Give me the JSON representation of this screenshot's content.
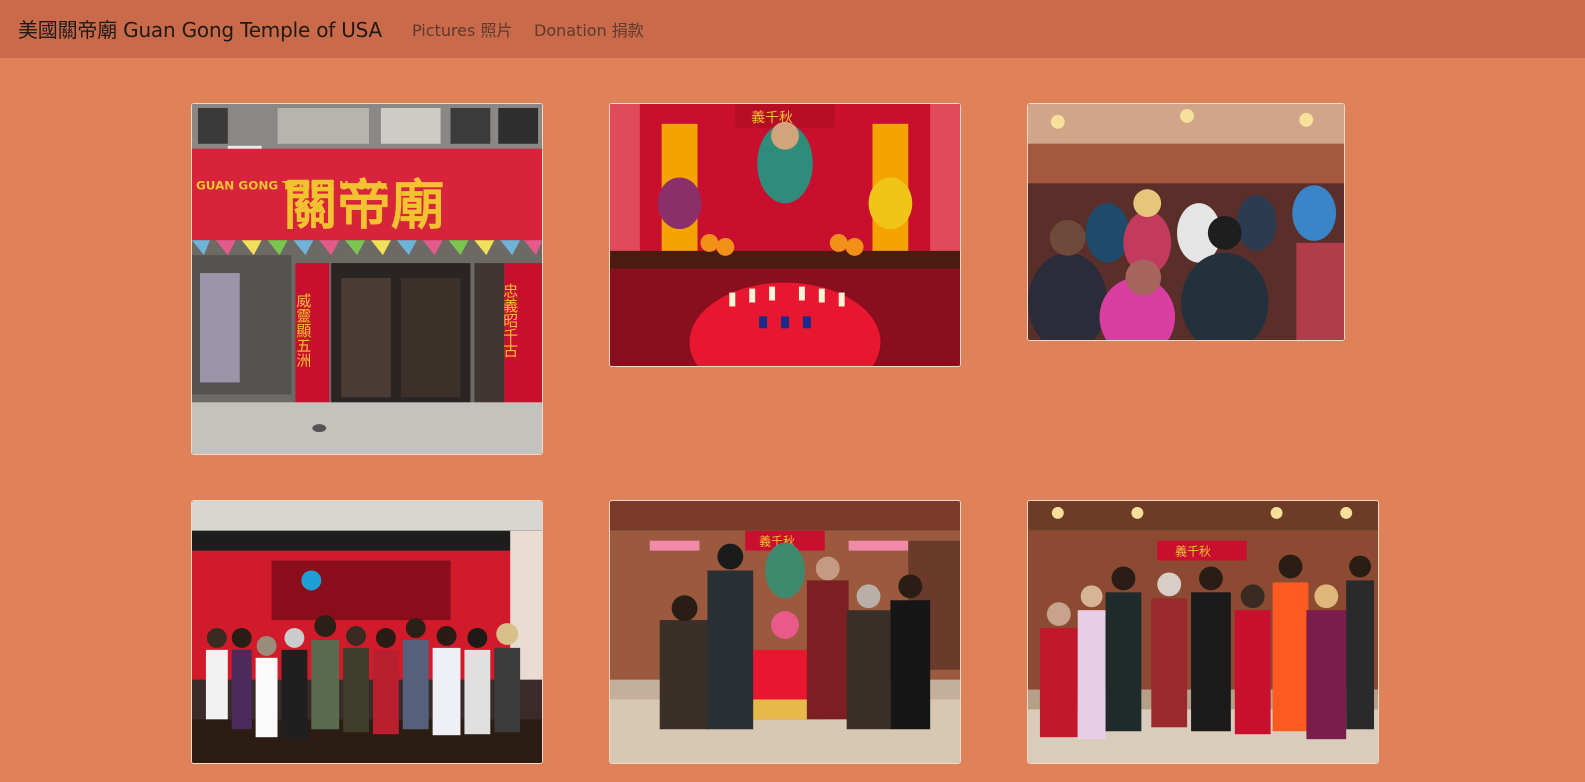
{
  "navbar": {
    "brand": "美國關帝廟 Guan Gong Temple of USA",
    "links": [
      {
        "label": "Pictures 照片"
      },
      {
        "label": "Donation 捐款"
      }
    ]
  },
  "gallery": {
    "photos": [
      {
        "subject": "temple-storefront",
        "sign_text": "關帝廟",
        "sign_left": "GUAN GONG TEMPLE U. S. A.",
        "left_banner": "威靈顯五洲",
        "right_banner": "忠義昭千古"
      },
      {
        "subject": "altar-with-statue",
        "banner": "義千秋"
      },
      {
        "subject": "crowd-inside-temple"
      },
      {
        "subject": "group-photo-banquet"
      },
      {
        "subject": "group-photo-altar-monks",
        "banner": "義千秋"
      },
      {
        "subject": "group-photo-temple-members",
        "banner": "義千秋"
      }
    ]
  },
  "colors": {
    "page_background": "#df8159",
    "navbar_background": "#c96a4b",
    "brand_text": "#1f1a17",
    "link_text": "#5e3a2c",
    "temple_red": "#c8102e",
    "temple_gold": "#f2c230"
  }
}
